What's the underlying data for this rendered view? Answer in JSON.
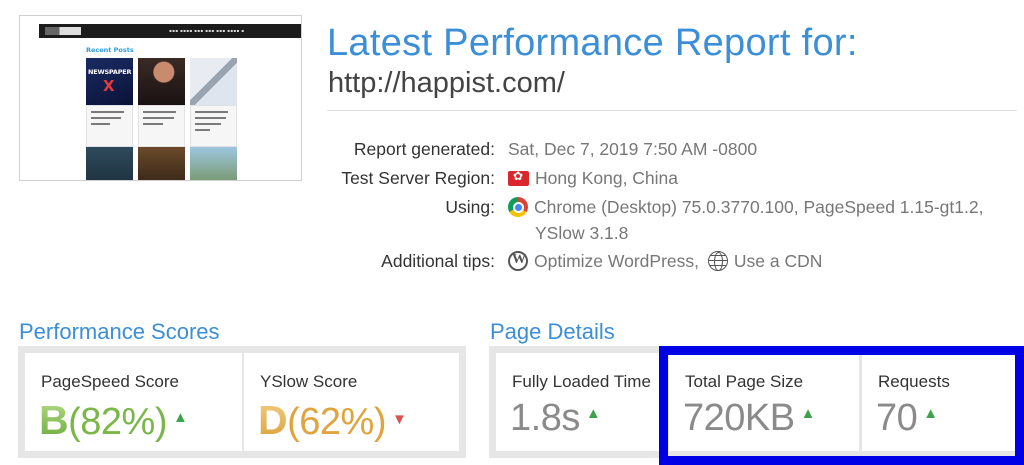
{
  "report": {
    "title": "Latest Performance Report for:",
    "url": "http://happist.com/",
    "rows": [
      {
        "label": "Report generated:",
        "value": "Sat, Dec 7, 2019 7:50 AM -0800"
      },
      {
        "label": "Test Server Region:",
        "value": "Hong Kong, China",
        "icon": "hong-kong-flag-icon"
      },
      {
        "label": "Using:",
        "value_line1": "Chrome (Desktop) 75.0.3770.100, PageSpeed 1.15-gt1.2,",
        "value_line2": "YSlow 3.1.8",
        "icon": "chrome-icon"
      },
      {
        "label": "Additional tips:",
        "tip1": "Optimize WordPress,",
        "tip1_icon": "wordpress-icon",
        "tip2": "Use a CDN",
        "tip2_icon": "globe-icon"
      }
    ]
  },
  "thumbnail": {
    "recent_posts": "Recent Posts",
    "tile_text": "NEWSPAPER",
    "tile_x": "X"
  },
  "performance_scores": {
    "title": "Performance Scores",
    "pagespeed": {
      "label": "PageSpeed Score",
      "grade": "B",
      "percent": "(82%)",
      "trend": "up"
    },
    "yslow": {
      "label": "YSlow Score",
      "grade": "D",
      "percent": "(62%)",
      "trend": "down"
    }
  },
  "page_details": {
    "title": "Page Details",
    "fully_loaded": {
      "label": "Fully Loaded Time",
      "value": "1.8s",
      "trend": "up"
    },
    "total_size": {
      "label": "Total Page Size",
      "value": "720KB",
      "trend": "up"
    },
    "requests": {
      "label": "Requests",
      "value": "70",
      "trend": "up"
    }
  },
  "colors": {
    "accent": "#3c8fd6",
    "grade_b": "#7ab648",
    "grade_d": "#e0a43e",
    "trend_up": "#3ea34a",
    "trend_down": "#d9534f",
    "highlight": "#0000e6"
  }
}
